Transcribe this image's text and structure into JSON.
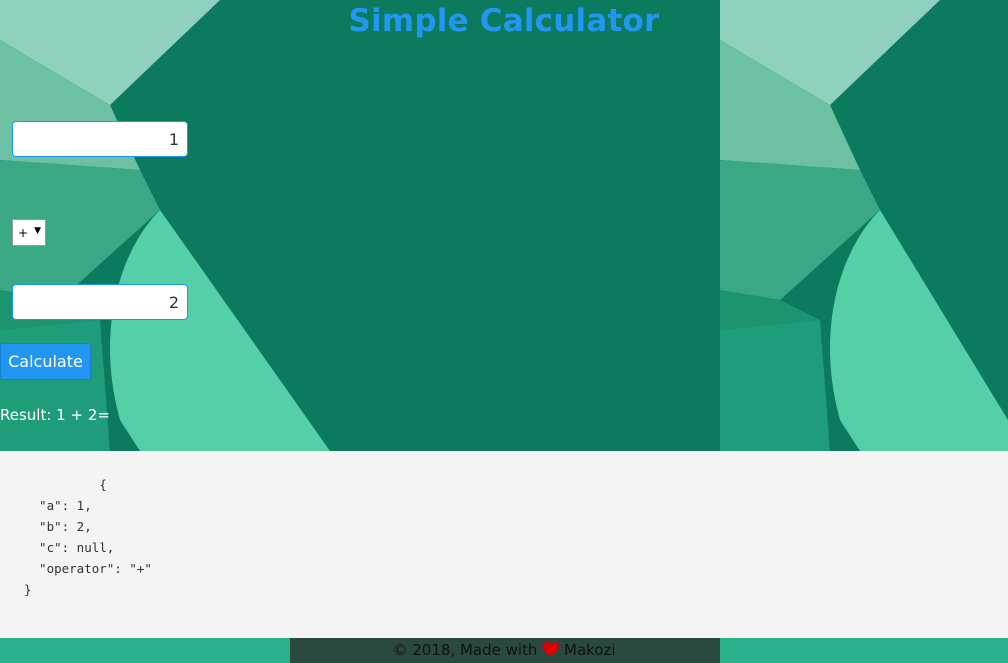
{
  "page": {
    "title": "Simple Calculator"
  },
  "form": {
    "a_value": "1",
    "operator": "+",
    "b_value": "2",
    "calculate_label": "Calculate"
  },
  "result_text": "Result: 1 + 2=",
  "json_lines": [
    "          {",
    "  \"a\": 1,",
    "  \"b\": 2,",
    "  \"c\": null,",
    "  \"operator\": \"+\"",
    "}"
  ],
  "footer": {
    "prefix": "© 2018, Made with",
    "author": "Makozi"
  },
  "colors": {
    "accent": "#2196f3",
    "heart": "#e00000",
    "panel": "#f4f4f4"
  }
}
